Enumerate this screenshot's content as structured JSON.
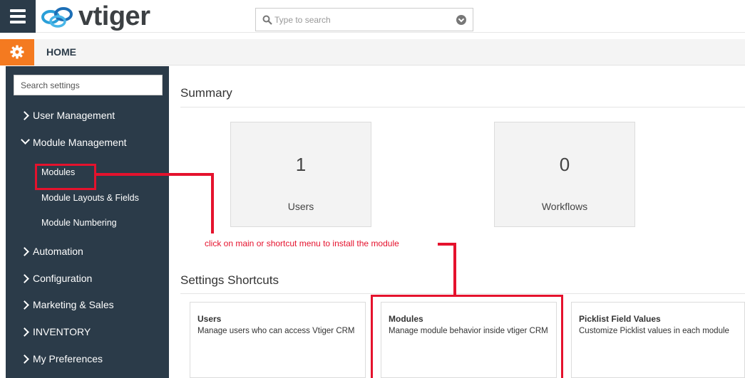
{
  "app": {
    "logo_text": "vtiger"
  },
  "search": {
    "placeholder": "Type to search"
  },
  "header": {
    "page_title": "HOME"
  },
  "sidebar": {
    "search_placeholder": "Search settings",
    "items": [
      {
        "label": "User Management",
        "expanded": false
      },
      {
        "label": "Module Management",
        "expanded": true
      },
      {
        "label": "Automation",
        "expanded": false
      },
      {
        "label": "Configuration",
        "expanded": false
      },
      {
        "label": "Marketing & Sales",
        "expanded": false
      },
      {
        "label": "INVENTORY",
        "expanded": false
      },
      {
        "label": "My Preferences",
        "expanded": false
      }
    ],
    "sub_items": [
      {
        "label": "Modules"
      },
      {
        "label": "Module Layouts & Fields"
      },
      {
        "label": "Module Numbering"
      }
    ]
  },
  "summary": {
    "title": "Summary",
    "cards": [
      {
        "value": "1",
        "label": "Users"
      },
      {
        "value": "0",
        "label": "Workflows"
      }
    ]
  },
  "shortcuts": {
    "title": "Settings Shortcuts",
    "cards": [
      {
        "title": "Users",
        "description": "Manage users who can access Vtiger CRM"
      },
      {
        "title": "Modules",
        "description": "Manage module behavior inside vtiger CRM"
      },
      {
        "title": "Picklist Field Values",
        "description": "Customize Picklist values in each module"
      }
    ]
  },
  "annotation": {
    "text": "click on main or shortcut menu to install the module"
  },
  "colors": {
    "sidebar_bg": "#2b3b49",
    "accent_orange": "#f47a20",
    "annotation_red": "#e5122d"
  }
}
